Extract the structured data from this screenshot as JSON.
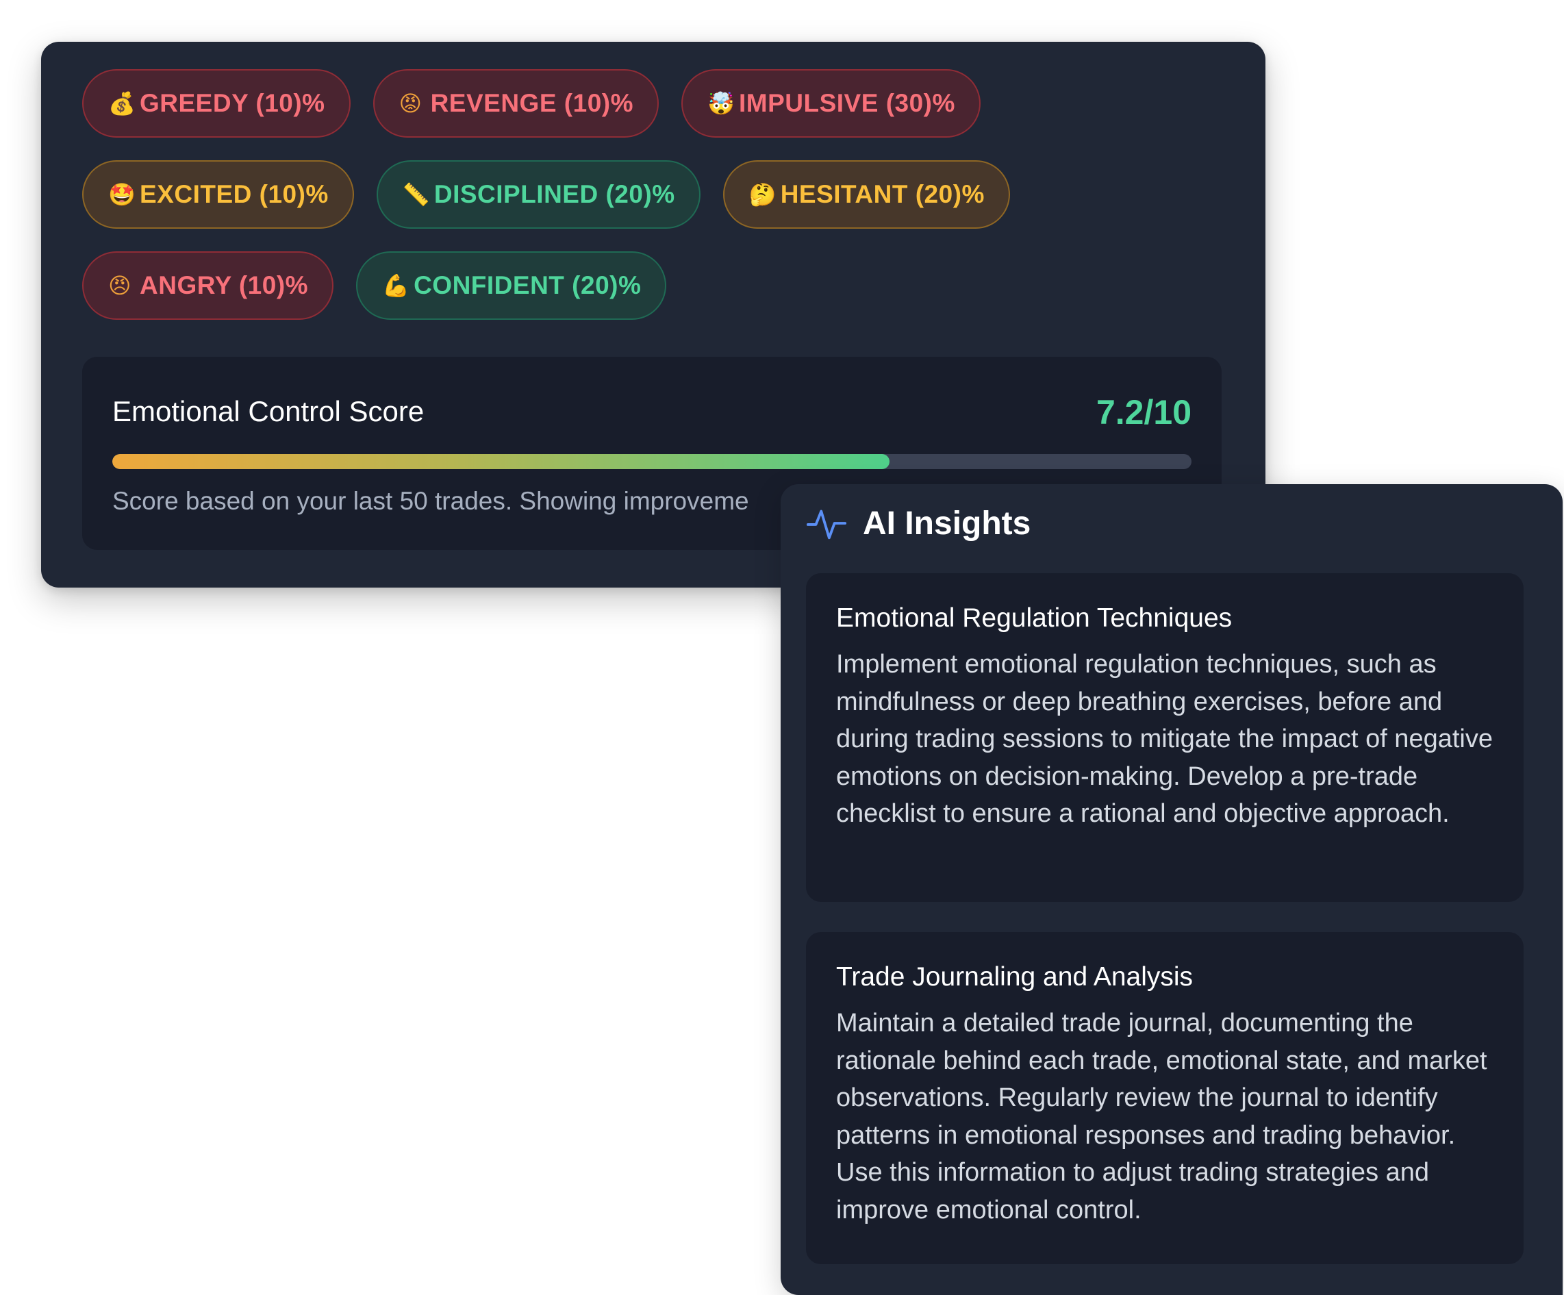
{
  "emotions": {
    "tags": [
      {
        "emoji": "💰",
        "icon": "money-bag-icon",
        "label": "GREEDY (10)%",
        "tone": "red"
      },
      {
        "emoji": "😡",
        "icon": "angry-face-icon",
        "label": "REVENGE (10)%",
        "tone": "red"
      },
      {
        "emoji": "🤯",
        "icon": "exploding-head-icon",
        "label": "IMPULSIVE (30)%",
        "tone": "red"
      },
      {
        "emoji": "🤩",
        "icon": "star-struck-icon",
        "label": "EXCITED (10)%",
        "tone": "amber"
      },
      {
        "emoji": "📏",
        "icon": "ruler-icon",
        "label": "DISCIPLINED (20)%",
        "tone": "green"
      },
      {
        "emoji": "🤔",
        "icon": "thinking-face-icon",
        "label": "HESITANT (20)%",
        "tone": "amber"
      },
      {
        "emoji": "😠",
        "icon": "frowning-face-icon",
        "label": "ANGRY (10)%",
        "tone": "red"
      },
      {
        "emoji": "💪",
        "icon": "flexed-biceps-icon",
        "label": "CONFIDENT (20)%",
        "tone": "green"
      }
    ],
    "colors": {
      "red_text": "#f8717a",
      "amber_text": "#fbbf3c",
      "green_text": "#4fd69c",
      "card_bg": "#202736",
      "inner_bg": "#181d2b"
    }
  },
  "score": {
    "title": "Emotional Control Score",
    "value": "7.2/10",
    "progress_fraction": 0.72,
    "note": "Score based on your last 50 trades. Showing improveme"
  },
  "insights": {
    "icon": "activity-pulse-icon",
    "title": "AI Insights",
    "items": [
      {
        "title": "Emotional Regulation Techniques",
        "body": "Implement emotional regulation techniques, such as mindfulness or deep breathing exercises, before and during trading sessions to mitigate the impact of negative emotions on decision-making. Develop a pre-trade checklist to ensure a rational and objective approach."
      },
      {
        "title": "Trade Journaling and Analysis",
        "body": "Maintain a detailed trade journal, documenting the rationale behind each trade, emotional state, and market observations. Regularly review the journal to identify patterns in emotional responses and trading behavior. Use this information to adjust trading strategies and improve emotional control."
      }
    ]
  }
}
